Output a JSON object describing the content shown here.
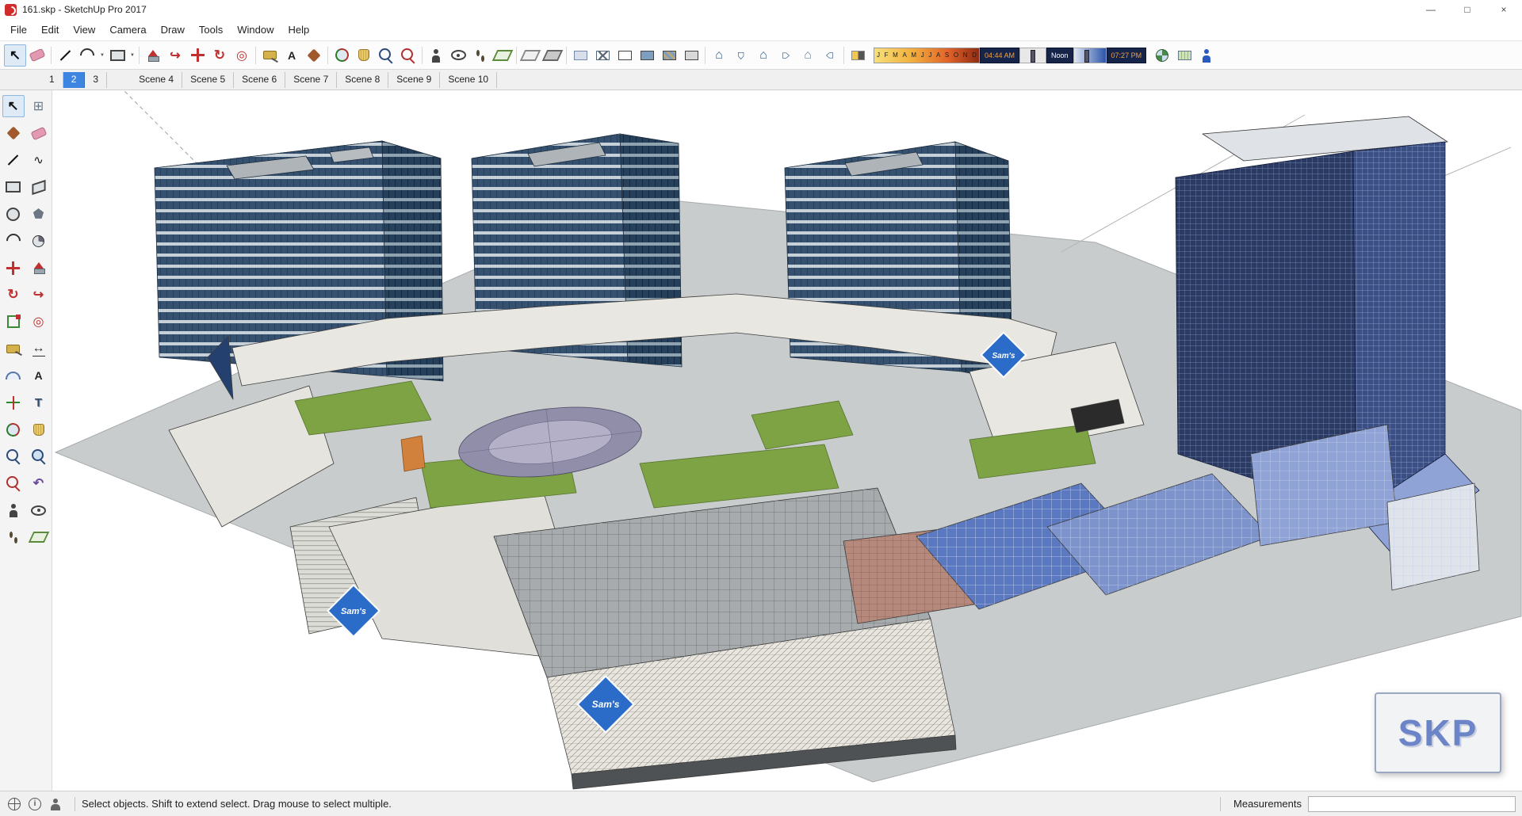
{
  "window": {
    "title": "161.skp - SketchUp Pro 2017",
    "controls": {
      "minimize": "—",
      "maximize": "□",
      "close": "×"
    }
  },
  "menu": {
    "items": [
      "File",
      "Edit",
      "View",
      "Camera",
      "Draw",
      "Tools",
      "Window",
      "Help"
    ]
  },
  "toolbar": {
    "icons": [
      {
        "name": "select-icon",
        "kind": "select"
      },
      {
        "name": "eraser-icon",
        "kind": "eraser"
      },
      {
        "name": "separator",
        "kind": "sep"
      },
      {
        "name": "line-tool-icon",
        "kind": "line"
      },
      {
        "name": "arcs-menu-icon",
        "kind": "arc"
      },
      {
        "name": "arcs-dropdown-icon",
        "kind": "dd"
      },
      {
        "name": "shapes-menu-icon",
        "kind": "rectangle"
      },
      {
        "name": "shapes-dropdown-icon",
        "kind": "dd"
      },
      {
        "name": "separator",
        "kind": "sep"
      },
      {
        "name": "push-pull-icon",
        "kind": "push-pull"
      },
      {
        "name": "follow-me-icon",
        "kind": "follow-me"
      },
      {
        "name": "move-icon",
        "kind": "move"
      },
      {
        "name": "rotate-icon",
        "kind": "rotate"
      },
      {
        "name": "offset-icon",
        "kind": "offset"
      },
      {
        "name": "separator",
        "kind": "sep"
      },
      {
        "name": "tape-measure-icon",
        "kind": "tape-measure"
      },
      {
        "name": "text-tool-icon",
        "kind": "text"
      },
      {
        "name": "paint-bucket-icon",
        "kind": "paint-bucket"
      },
      {
        "name": "separator",
        "kind": "sep"
      },
      {
        "name": "orbit-icon",
        "kind": "orbit"
      },
      {
        "name": "pan-icon",
        "kind": "pan"
      },
      {
        "name": "zoom-icon",
        "kind": "zoom"
      },
      {
        "name": "zoom-extents-icon",
        "kind": "zoom-extents"
      },
      {
        "name": "separator",
        "kind": "sep"
      },
      {
        "name": "position-camera-icon",
        "kind": "position-camera"
      },
      {
        "name": "look-around-icon",
        "kind": "look-around"
      },
      {
        "name": "walk-icon",
        "kind": "walk"
      },
      {
        "name": "section-plane-icon",
        "kind": "section-plane"
      },
      {
        "name": "separator",
        "kind": "sep"
      },
      {
        "name": "section-display-toggle-icon",
        "kind": "section-display"
      },
      {
        "name": "section-cut-toggle-icon",
        "kind": "section-cut"
      },
      {
        "name": "separator",
        "kind": "sep"
      },
      {
        "name": "xray-style-icon",
        "kind": "xray"
      },
      {
        "name": "wireframe-style-icon",
        "kind": "wireframe"
      },
      {
        "name": "hidden-line-style-icon",
        "kind": "hidden-line"
      },
      {
        "name": "shaded-style-icon",
        "kind": "shaded"
      },
      {
        "name": "shaded-textures-style-icon",
        "kind": "shaded-textures"
      },
      {
        "name": "monochrome-style-icon",
        "kind": "monochrome"
      },
      {
        "name": "separator",
        "kind": "sep"
      },
      {
        "name": "iso-view-icon",
        "kind": "iso-view"
      },
      {
        "name": "top-view-icon",
        "kind": "top-view"
      },
      {
        "name": "front-view-icon",
        "kind": "front-view"
      },
      {
        "name": "right-view-icon",
        "kind": "right-view"
      },
      {
        "name": "back-view-icon",
        "kind": "back-view"
      },
      {
        "name": "left-view-icon",
        "kind": "left-view"
      },
      {
        "name": "separator",
        "kind": "sep"
      },
      {
        "name": "shadows-toggle-icon",
        "kind": "shadows-toggle"
      }
    ],
    "icons_right": [
      {
        "name": "get-location-icon",
        "kind": "get-location"
      },
      {
        "name": "toggle-terrain-icon",
        "kind": "toggle-terrain"
      },
      {
        "name": "photo-textures-icon",
        "kind": "photo-textures"
      }
    ],
    "shadow": {
      "months": [
        "J",
        "F",
        "M",
        "A",
        "M",
        "J",
        "J",
        "A",
        "S",
        "O",
        "N",
        "D"
      ],
      "sunrise": "04:44 AM",
      "noon": "Noon",
      "sunset": "07:27 PM"
    }
  },
  "scenes": {
    "tabs": [
      {
        "label": "1"
      },
      {
        "label": "2",
        "active": true
      },
      {
        "label": "3",
        "gap": true
      },
      {
        "label": "Scene 4"
      },
      {
        "label": "Scene 5"
      },
      {
        "label": "Scene 6"
      },
      {
        "label": "Scene 7"
      },
      {
        "label": "Scene 8"
      },
      {
        "label": "Scene 9"
      },
      {
        "label": "Scene 10"
      }
    ]
  },
  "left_tools": [
    {
      "name": "select-tool",
      "kind": "select"
    },
    {
      "name": "make-component-tool",
      "kind": "make-component"
    },
    {
      "name": "paint-bucket-tool",
      "kind": "paint-bucket"
    },
    {
      "name": "eraser-tool",
      "kind": "eraser"
    },
    {
      "name": "line-tool",
      "kind": "line"
    },
    {
      "name": "freehand-tool",
      "kind": "freehand"
    },
    {
      "name": "rectangle-tool",
      "kind": "rectangle"
    },
    {
      "name": "rotated-rectangle-tool",
      "kind": "rotated-rectangle"
    },
    {
      "name": "circle-tool",
      "kind": "circle"
    },
    {
      "name": "polygon-tool",
      "kind": "polygon"
    },
    {
      "name": "arc-tool",
      "kind": "arc"
    },
    {
      "name": "pie-tool",
      "kind": "pie"
    },
    {
      "name": "move-tool",
      "kind": "move"
    },
    {
      "name": "push-pull-tool",
      "kind": "push-pull"
    },
    {
      "name": "rotate-tool",
      "kind": "rotate"
    },
    {
      "name": "follow-me-tool",
      "kind": "follow-me"
    },
    {
      "name": "scale-tool",
      "kind": "scale"
    },
    {
      "name": "offset-tool",
      "kind": "offset"
    },
    {
      "name": "tape-measure-tool",
      "kind": "tape-measure"
    },
    {
      "name": "dimension-tool",
      "kind": "dimension"
    },
    {
      "name": "protractor-tool",
      "kind": "protractor"
    },
    {
      "name": "text-tool",
      "kind": "text"
    },
    {
      "name": "axes-tool",
      "kind": "axes"
    },
    {
      "name": "3d-text-tool",
      "kind": "3d-text"
    },
    {
      "name": "orbit-tool",
      "kind": "orbit"
    },
    {
      "name": "pan-tool",
      "kind": "pan"
    },
    {
      "name": "zoom-tool",
      "kind": "zoom"
    },
    {
      "name": "zoom-window-tool",
      "kind": "zoom-window"
    },
    {
      "name": "zoom-extents-tool",
      "kind": "zoom-extents"
    },
    {
      "name": "previous-view-tool",
      "kind": "previous"
    },
    {
      "name": "position-camera-tool",
      "kind": "position-camera"
    },
    {
      "name": "look-around-tool",
      "kind": "look-around"
    },
    {
      "name": "walk-tool",
      "kind": "walk"
    },
    {
      "name": "section-plane-tool",
      "kind": "section-plane"
    }
  ],
  "viewport": {
    "sams_label": "Sam's",
    "watermark": "SKP"
  },
  "statusbar": {
    "hint": "Select objects. Shift to extend select. Drag mouse to select multiple.",
    "measurements_label": "Measurements",
    "measurements_value": ""
  }
}
